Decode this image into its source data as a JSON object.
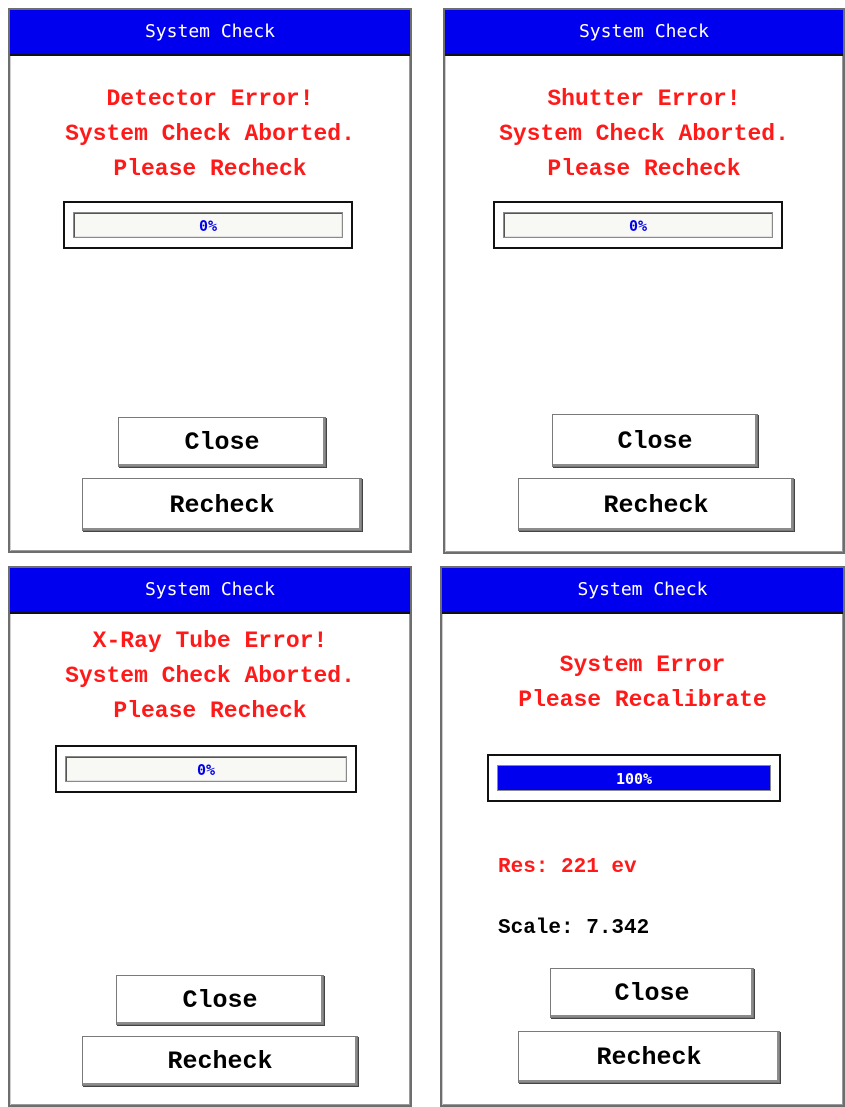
{
  "dialogs": [
    {
      "title": "System Check",
      "message_lines": [
        "Detector Error!",
        "System Check Aborted.",
        "Please Recheck"
      ],
      "progress": {
        "label": "0%",
        "fraction": 0
      },
      "close_label": "Close",
      "recheck_label": "Recheck"
    },
    {
      "title": "System Check",
      "message_lines": [
        "Shutter Error!",
        "System Check Aborted.",
        "Please Recheck"
      ],
      "progress": {
        "label": "0%",
        "fraction": 0
      },
      "close_label": "Close",
      "recheck_label": "Recheck"
    },
    {
      "title": "System Check",
      "message_lines": [
        "X-Ray Tube Error!",
        "System Check Aborted.",
        "Please Recheck"
      ],
      "progress": {
        "label": "0%",
        "fraction": 0
      },
      "close_label": "Close",
      "recheck_label": "Recheck"
    },
    {
      "title": "System Check",
      "message_lines": [
        "System Error",
        "Please Recalibrate"
      ],
      "progress": {
        "label": "100%",
        "fraction": 1
      },
      "resolution_text": "Res: 221 ev",
      "scale_text": "Scale: 7.342",
      "close_label": "Close",
      "recheck_label": "Recheck"
    }
  ],
  "colors": {
    "titlebar_bg": "#0000ee",
    "error_text": "#ff1a1a",
    "progress_fill": "#0000ee"
  }
}
